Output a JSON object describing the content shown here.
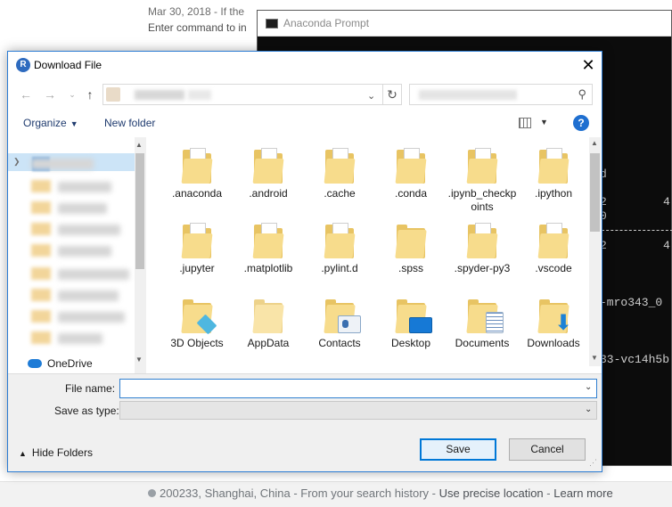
{
  "background_page": {
    "top_link": "https://www.digitalocean.com/download-install-Prototest.html",
    "date_text": "Mar 30, 2018 - If the",
    "line_text": "Enter command to in",
    "footer": {
      "location": "200233, Shanghai, China",
      "source": " - From your search history - ",
      "precise": "Use precise location",
      "sep": " - ",
      "learn": "Learn more"
    }
  },
  "conda_window": {
    "title": "Anaconda Prompt",
    "lines": [
      "d",
      "2",
      "0",
      "2",
      "-mro343_0",
      "33-vc14h5b"
    ],
    "right_vals": [
      "4",
      "4"
    ]
  },
  "dialog": {
    "title": "Download File",
    "nav": {
      "back_icon": "arrow-left-icon",
      "forward_icon": "arrow-right-icon",
      "up_icon": "arrow-up-icon",
      "refresh_icon": "refresh-icon",
      "search_icon": "magnifier-icon"
    },
    "toolbar": {
      "organize": "Organize",
      "new_folder": "New folder",
      "help": "?"
    },
    "navpane": {
      "quick_access": "Quick access",
      "onedrive": "OneDrive"
    },
    "files": [
      {
        "name": ".anaconda",
        "kind": "folder-doc"
      },
      {
        "name": ".android",
        "kind": "folder-doc"
      },
      {
        "name": ".cache",
        "kind": "folder-doc"
      },
      {
        "name": ".conda",
        "kind": "folder-doc"
      },
      {
        "name": ".ipynb_checkpoints",
        "kind": "folder-doc"
      },
      {
        "name": ".ipython",
        "kind": "folder-doc"
      },
      {
        "name": ".jupyter",
        "kind": "folder-doc"
      },
      {
        "name": ".matplotlib",
        "kind": "folder-doc"
      },
      {
        "name": ".pylint.d",
        "kind": "folder-doc"
      },
      {
        "name": ".spss",
        "kind": "folder-empty"
      },
      {
        "name": ".spyder-py3",
        "kind": "folder-doc"
      },
      {
        "name": ".vscode",
        "kind": "folder-doc"
      },
      {
        "name": "3D Objects",
        "kind": "3d-objects"
      },
      {
        "name": "AppData",
        "kind": "folder-empty"
      },
      {
        "name": "Contacts",
        "kind": "contacts"
      },
      {
        "name": "Desktop",
        "kind": "desktop"
      },
      {
        "name": "Documents",
        "kind": "documents"
      },
      {
        "name": "Downloads",
        "kind": "downloads"
      }
    ],
    "form": {
      "file_name_label": "File name:",
      "file_name_value": "",
      "save_as_type_label": "Save as type:",
      "save_as_type_value": "",
      "hide_folders": "Hide Folders",
      "save": "Save",
      "cancel": "Cancel"
    }
  }
}
